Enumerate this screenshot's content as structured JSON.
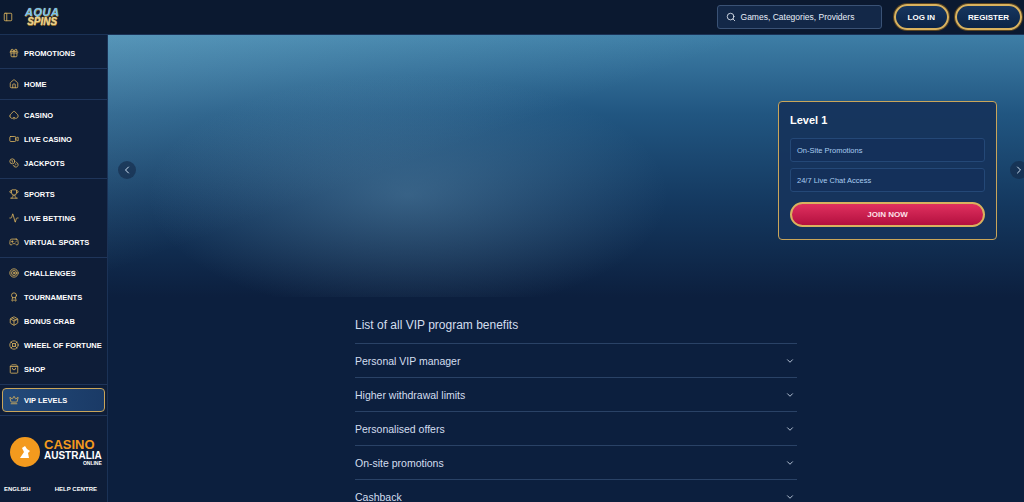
{
  "logo": {
    "line1": "AQUA",
    "line2": "SPINS"
  },
  "search": {
    "placeholder": "Games, Categories, Providers"
  },
  "header_buttons": [
    {
      "label": "LOG IN"
    },
    {
      "label": "REGISTER"
    }
  ],
  "sidebar": {
    "groups": [
      {
        "items": [
          {
            "label": "PROMOTIONS",
            "selected": false
          }
        ]
      },
      {
        "items": [
          {
            "label": "HOME",
            "selected": false
          }
        ]
      },
      {
        "items": [
          {
            "label": "CASINO",
            "selected": false
          },
          {
            "label": "LIVE CASINO",
            "selected": false
          },
          {
            "label": "JACKPOTS",
            "selected": false
          }
        ]
      },
      {
        "items": [
          {
            "label": "SPORTS",
            "selected": false
          },
          {
            "label": "LIVE BETTING",
            "selected": false
          },
          {
            "label": "VIRTUAL SPORTS",
            "selected": false
          }
        ]
      },
      {
        "items": [
          {
            "label": "CHALLENGES",
            "selected": false
          },
          {
            "label": "TOURNAMENTS",
            "selected": false
          },
          {
            "label": "BONUS CRAB",
            "selected": false
          },
          {
            "label": "WHEEL OF FORTUNE",
            "selected": false
          },
          {
            "label": "SHOP",
            "selected": false
          }
        ]
      },
      {
        "items": [
          {
            "label": "VIP LEVELS",
            "selected": true
          }
        ]
      }
    ]
  },
  "footer_links": [
    "ENGLISH",
    "HELP CENTRE"
  ],
  "level_card": {
    "title": "Level 1",
    "perks": [
      "On-Site Promotions",
      "24/7 Live Chat Access"
    ],
    "button": "JOIN NOW"
  },
  "benefits": {
    "title": "List of all VIP program benefits",
    "items": [
      {
        "label": "Personal VIP manager",
        "expanded": false
      },
      {
        "label": "Higher withdrawal limits",
        "expanded": false
      },
      {
        "label": "Personalised offers",
        "expanded": false
      },
      {
        "label": "On-site promotions",
        "expanded": false
      },
      {
        "label": "Cashback",
        "expanded": false
      }
    ]
  },
  "watermark": {
    "line1": "CASINO",
    "line2": "AUSTRALIA",
    "line3": "ONLINE"
  }
}
